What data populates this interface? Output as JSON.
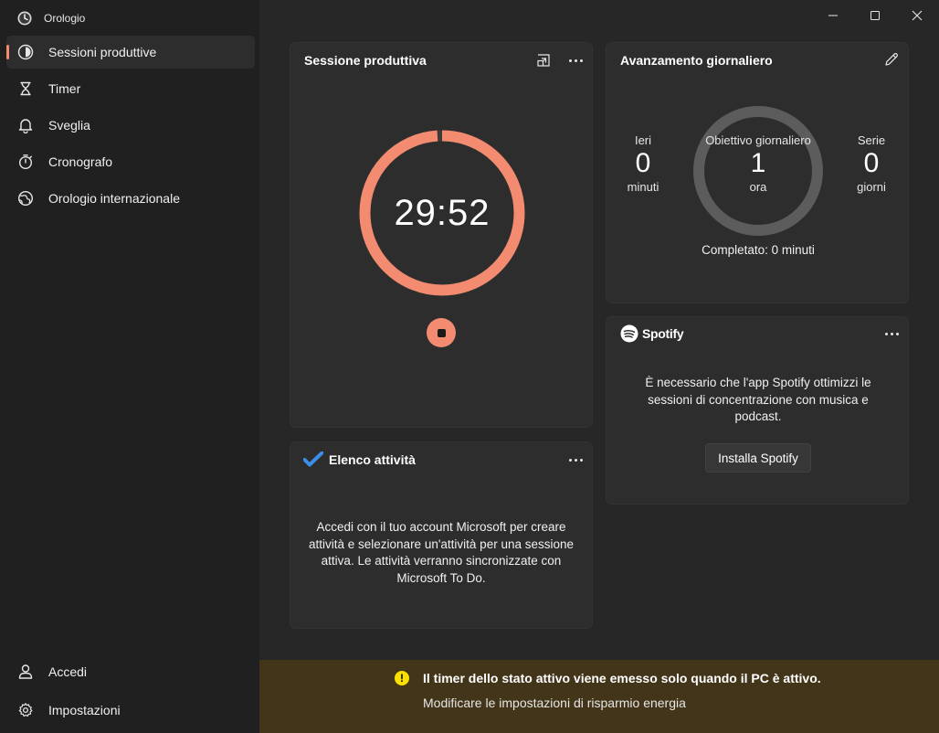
{
  "app": {
    "title": "Orologio"
  },
  "sidebar": {
    "items": [
      {
        "label": "Sessioni produttive",
        "icon": "focus-icon",
        "active": true
      },
      {
        "label": "Timer",
        "icon": "hourglass-icon"
      },
      {
        "label": "Sveglia",
        "icon": "bell-icon"
      },
      {
        "label": "Cronografo",
        "icon": "stopwatch-icon"
      },
      {
        "label": "Orologio internazionale",
        "icon": "globe-icon"
      }
    ],
    "bottom": [
      {
        "label": "Accedi",
        "icon": "person-icon"
      },
      {
        "label": "Impostazioni",
        "icon": "gear-icon"
      }
    ]
  },
  "session_card": {
    "title": "Sessione produttiva",
    "timer": "29:52",
    "progress": 0.99,
    "accent": "#f28b6f"
  },
  "tasks_card": {
    "title": "Elenco attività",
    "body": "Accedi con il tuo account Microsoft per creare attività e selezionare un'attività per una sessione attiva. Le attività verranno sincronizzate con Microsoft To Do."
  },
  "daily_card": {
    "title": "Avanzamento giornaliero",
    "yesterday": {
      "label": "Ieri",
      "value": "0",
      "unit": "minuti"
    },
    "goal": {
      "label": "Obiettivo giornaliero",
      "value": "1",
      "unit": "ora"
    },
    "streak": {
      "label": "Serie",
      "value": "0",
      "unit": "giorni"
    },
    "completed": "Completato: 0 minuti"
  },
  "spotify_card": {
    "brand": "Spotify",
    "body": "È necessario che l'app Spotify ottimizzi le sessioni di concentrazione con musica e podcast.",
    "button": "Installa Spotify"
  },
  "banner": {
    "message": "Il timer dello stato attivo viene emesso solo quando il PC è attivo.",
    "link": "Modificare le impostazioni di risparmio energia",
    "color": "#433519"
  }
}
